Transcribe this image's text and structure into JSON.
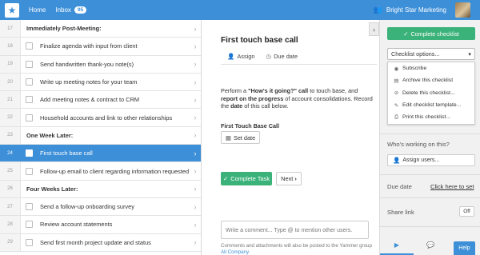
{
  "topbar": {
    "home_label": "Home",
    "inbox_label": "Inbox",
    "inbox_count": "95",
    "org_name": "Bright Star Marketing",
    "brand_color": "#3d8fd8"
  },
  "list": {
    "rows": [
      {
        "num": "17",
        "text": "Immediately Post-Meeting:",
        "header": true
      },
      {
        "num": "18",
        "text": "Finalize agenda with input from client"
      },
      {
        "num": "19",
        "text": "Send handwritten thank-you note(s)"
      },
      {
        "num": "20",
        "text": "Write up meeting notes for your team"
      },
      {
        "num": "21",
        "text": "Add meeting notes & contract to CRM"
      },
      {
        "num": "22",
        "text": "Household accounts and link to other relationships"
      },
      {
        "num": "23",
        "text": "One Week Later:",
        "header": true
      },
      {
        "num": "24",
        "text": "First touch base call",
        "active": true
      },
      {
        "num": "25",
        "text": "Follow-up email to client regarding information requested at initi"
      },
      {
        "num": "26",
        "text": "Four Weeks Later:",
        "header": true
      },
      {
        "num": "27",
        "text": "Send a follow-up onboarding survey"
      },
      {
        "num": "28",
        "text": "Review account statements"
      },
      {
        "num": "29",
        "text": "Send first month project update and status"
      }
    ]
  },
  "detail": {
    "title": "First touch base call",
    "assign_label": "Assign",
    "due_date_label": "Due date",
    "desc_1": "Perform a ",
    "desc_b1": "\"How's it going?\" call",
    "desc_2": " to touch base, and ",
    "desc_b2": "report on the progress",
    "desc_3": " of account consolidations. Record the ",
    "desc_b3": "date",
    "desc_4": " of this call below.",
    "field_label": "First Touch Base Call",
    "set_date_label": "Set date",
    "complete_task_label": "Complete Task",
    "next_label": "Next",
    "comment_placeholder": "Write a comment... Type @ to mention other users.",
    "note_text": "Comments and attachments will also be posted to the Yammer group ",
    "note_link": "All Company",
    "note_end": "."
  },
  "sidebar": {
    "complete_checklist_label": "Complete checklist",
    "options_label": "Checklist options...",
    "menu": [
      {
        "icon": "rss-icon",
        "glyph": "◉",
        "label": "Subscribe"
      },
      {
        "icon": "archive-icon",
        "glyph": "▤",
        "label": "Archive this checklist"
      },
      {
        "icon": "delete-icon",
        "glyph": "⊘",
        "label": "Delete this checklist..."
      },
      {
        "icon": "edit-icon",
        "glyph": "✎",
        "label": "Edit checklist template..."
      },
      {
        "icon": "print-icon",
        "glyph": "⎙",
        "label": "Print this checklist..."
      }
    ],
    "who_working_label": "Who's working on this?",
    "assign_users_label": "Assign users...",
    "due_date_label": "Due date",
    "click_to_set_label": "Click here to set",
    "share_link_label": "Share link",
    "share_toggle_label": "Off",
    "help_label": "Help",
    "accent_green": "#3bb279"
  }
}
